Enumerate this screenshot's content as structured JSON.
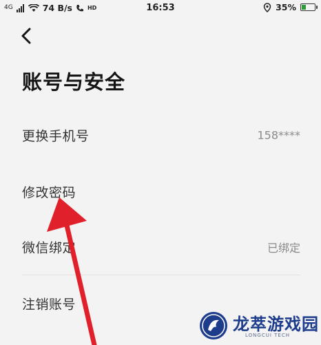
{
  "status_bar": {
    "network_label": "4G",
    "speed": "74 B/s",
    "hd_label": "HD",
    "time": "16:53",
    "battery_text": "35%",
    "battery_level": 0.35,
    "battery_color": "#2f9a3a"
  },
  "header": {
    "back_icon": "chevron-left-icon",
    "title": "账号与安全"
  },
  "settings": {
    "items": [
      {
        "label": "更换手机号",
        "value": "158****"
      },
      {
        "label": "修改密码",
        "value": ""
      },
      {
        "label": "微信绑定",
        "value": "已绑定"
      },
      {
        "label": "注销账号",
        "value": ""
      }
    ]
  },
  "annotation": {
    "arrow_color": "#e0202a"
  },
  "watermark": {
    "name": "龙萃游戏园",
    "subtitle": "LONGCUI TECH"
  }
}
